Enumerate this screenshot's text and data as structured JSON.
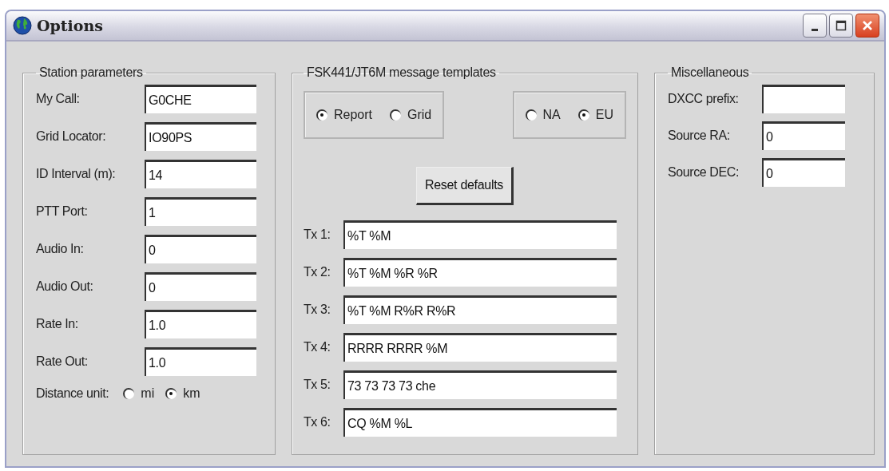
{
  "window": {
    "title": "Options"
  },
  "station": {
    "title": "Station parameters",
    "fields": [
      {
        "label": "My Call:",
        "value": "G0CHE"
      },
      {
        "label": "Grid Locator:",
        "value": "IO90PS"
      },
      {
        "label": "ID Interval (m):",
        "value": "14"
      },
      {
        "label": "PTT Port:",
        "value": "1"
      },
      {
        "label": "Audio In:",
        "value": "0"
      },
      {
        "label": "Audio Out:",
        "value": "0"
      },
      {
        "label": "Rate In:",
        "value": "1.0"
      },
      {
        "label": "Rate Out:",
        "value": "1.0"
      }
    ],
    "distance": {
      "label": "Distance unit:",
      "options": [
        {
          "label": "mi",
          "selected": false
        },
        {
          "label": "km",
          "selected": true
        }
      ]
    }
  },
  "templates": {
    "title": "FSK441/JT6M message templates",
    "radio_groups": [
      [
        {
          "label": "Report",
          "selected": true
        },
        {
          "label": "Grid",
          "selected": false
        }
      ],
      [
        {
          "label": "NA",
          "selected": false
        },
        {
          "label": "EU",
          "selected": true
        }
      ]
    ],
    "reset_button": "Reset defaults",
    "fields": [
      {
        "label": "Tx 1:",
        "value": "%T %M"
      },
      {
        "label": "Tx 2:",
        "value": "%T %M %R %R"
      },
      {
        "label": "Tx 3:",
        "value": "%T %M R%R R%R"
      },
      {
        "label": "Tx 4:",
        "value": "RRRR RRRR %M"
      },
      {
        "label": "Tx 5:",
        "value": "73 73 73 73 che"
      },
      {
        "label": "Tx 6:",
        "value": "CQ %M %L"
      }
    ]
  },
  "misc": {
    "title": "Miscellaneous",
    "fields": [
      {
        "label": "DXCC prefix:"
      },
      {
        "label": "Source RA:",
        "value": "0"
      },
      {
        "label": "Source DEC:",
        "value": "0"
      }
    ]
  }
}
